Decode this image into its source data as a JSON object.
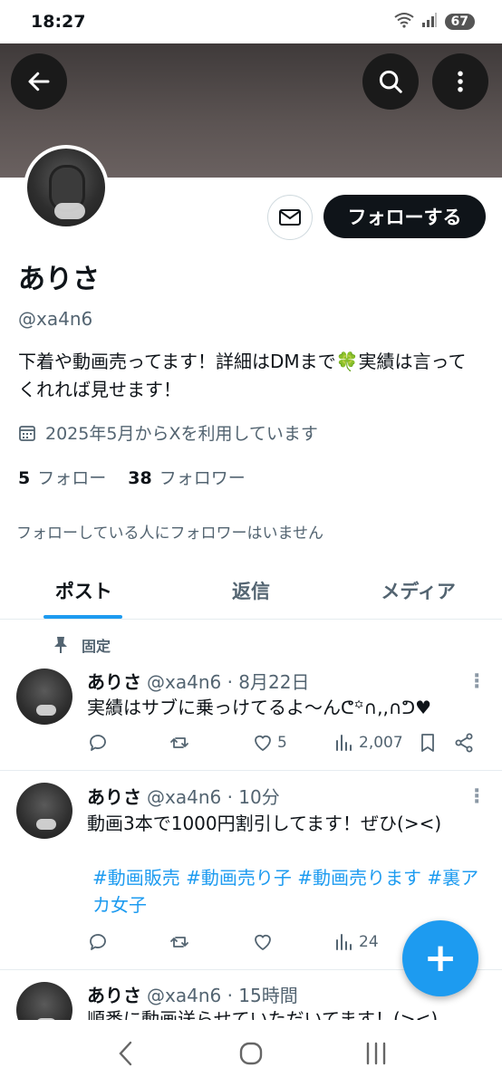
{
  "status_bar": {
    "time": "18:27",
    "battery": "67"
  },
  "profile": {
    "name": "ありさ",
    "handle": "@xa4n6",
    "bio": "下着や動画売ってます！詳細はDMまで🍀実績は言ってくれれば見せます！",
    "joined": "2025年5月からXを利用しています",
    "following_count": "5",
    "following_label": "フォロー",
    "followers_count": "38",
    "followers_label": "フォロワー",
    "mutual_note": "フォローしている人にフォロワーはいません",
    "follow_button": "フォローする"
  },
  "tabs": [
    {
      "label": "ポスト",
      "active": true
    },
    {
      "label": "返信",
      "active": false
    },
    {
      "label": "メディア",
      "active": false
    }
  ],
  "pinned_label": "固定",
  "posts": [
    {
      "name": "ありさ",
      "meta": "@xa4n6 · 8月22日",
      "text": "実績はサブに乗っけてるよ〜んᕦ꙳∩,,∩ᕤ♥",
      "hashtags": "",
      "likes": "5",
      "views": "2,007"
    },
    {
      "name": "ありさ",
      "meta": "@xa4n6 · 10分",
      "text": "動画3本で1000円割引してます！ぜひ(><)",
      "hashtags": "#動画販売 #動画売り子 #動画売ります #裏アカ女子",
      "likes": "",
      "views": "24"
    },
    {
      "name": "ありさ",
      "meta": "@xa4n6 · 15時間",
      "text": "順番に動画送らせていただいてます！(><)",
      "hashtags": "",
      "likes": "",
      "views": ""
    }
  ],
  "colors": {
    "accent": "#1d9bf0",
    "text": "#0f1419",
    "muted": "#536471"
  }
}
